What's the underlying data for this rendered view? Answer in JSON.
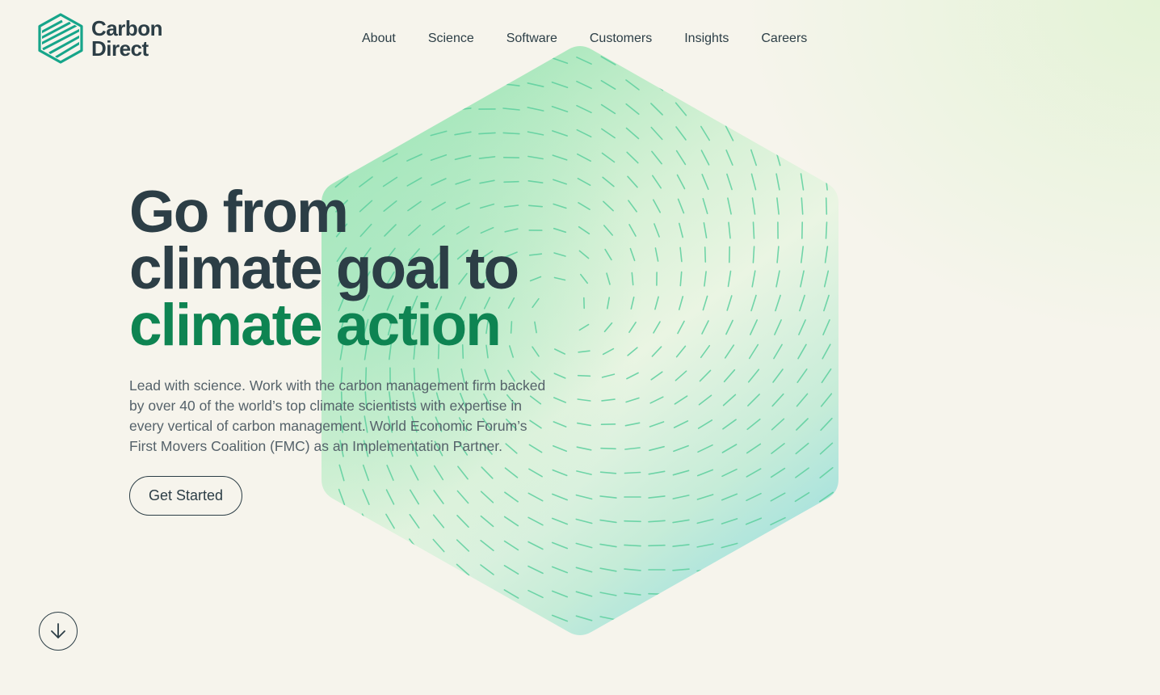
{
  "brand": {
    "name_line1": "Carbon",
    "name_line2": "Direct",
    "logo_icon": "hexagon-stripes-logo",
    "logo_color": "#16a58a"
  },
  "nav": {
    "items": [
      {
        "label": "About"
      },
      {
        "label": "Science"
      },
      {
        "label": "Software"
      },
      {
        "label": "Customers"
      },
      {
        "label": "Insights"
      },
      {
        "label": "Careers"
      }
    ]
  },
  "hero": {
    "headline_line1": "Go from",
    "headline_line2": "climate goal to",
    "headline_line3": "climate action",
    "description": "Lead with science. Work with the carbon management firm backed by over 40 of the world’s top climate scientists with expertise in every vertical of carbon management. World Economic Forum’s First Movers Coalition (FMC) as an Implementation Partner.",
    "cta_label": "Get Started"
  },
  "scroll": {
    "icon": "arrow-down-icon"
  },
  "colors": {
    "background": "#f6f4ec",
    "text_dark": "#2c3e46",
    "accent_green": "#0e8452",
    "hex_green": "#9fe4b4",
    "hex_cyan": "#9fdfe0"
  }
}
